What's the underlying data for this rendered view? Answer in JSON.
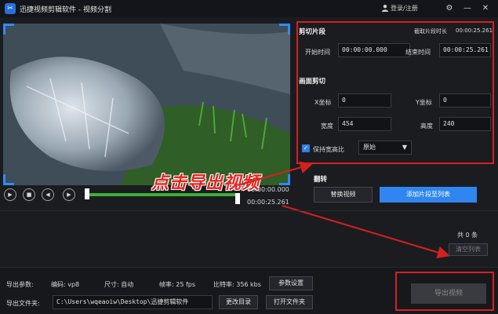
{
  "titlebar": {
    "app_logo": "✂",
    "app_title": "迅捷视频剪辑软件 - 视频分割",
    "login": "登录/注册",
    "settings": "⚙",
    "minimize": "—",
    "close": "✕"
  },
  "clip": {
    "title": "剪切片段",
    "length_label": "截取片段时长",
    "length_value": "00:00:25.261",
    "start_label": "开始时间",
    "start_value": "00:00:00.000",
    "end_label": "结束时间",
    "end_value": "00:00:25.261"
  },
  "crop": {
    "title": "画面剪切",
    "x_label": "X坐标",
    "x_value": "0",
    "y_label": "Y坐标",
    "y_value": "0",
    "width_label": "宽度",
    "width_value": "454",
    "height_label": "高度",
    "height_value": "240",
    "keep_ratio_label": "保持宽高比",
    "ratio_option": "原始"
  },
  "flip": {
    "title": "翻转"
  },
  "player": {
    "time_start": "00:00:00.000",
    "time_end": "00:00:25.261",
    "play": "▶",
    "stop": "■",
    "prev": "◀",
    "next": "▶"
  },
  "actions": {
    "replace_video": "替换视频",
    "add_clip": "添加片段至列表"
  },
  "list": {
    "count": "共 0 条",
    "clear": "清空列表"
  },
  "overlay": {
    "hint": "点击导出视频"
  },
  "export": {
    "params_label": "导出参数:",
    "codec": "编码: vp8",
    "size": "尺寸: 自动",
    "fps": "帧率: 25 fps",
    "bitrate": "比特率: 356 kbs",
    "params_button": "参数设置",
    "dir_label": "导出文件夹:",
    "dir_path": "C:\\Users\\wqeaoiw\\Desktop\\迅捷剪辑软件",
    "change_dir": "更改目录",
    "open_folder": "打开文件夹",
    "export_button": "导出视频"
  },
  "colors": {
    "accent": "#2f86f0",
    "annotation_red": "#d32020",
    "timeline_green": "#3fae3a"
  }
}
